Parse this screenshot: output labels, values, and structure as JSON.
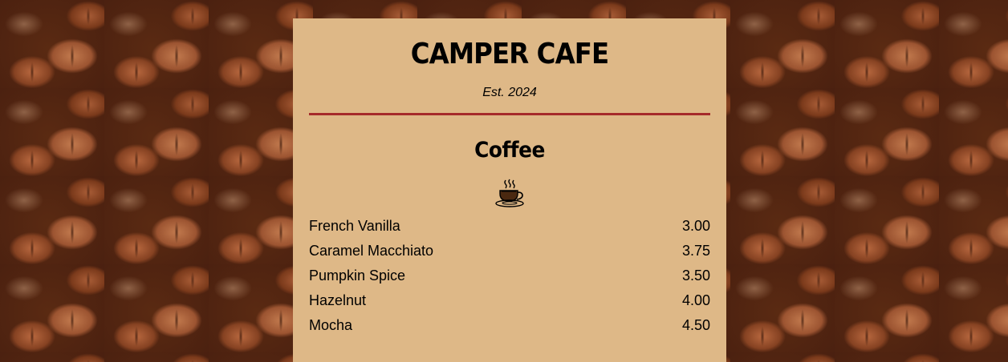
{
  "cafe": {
    "name": "CAMPER CAFE",
    "established": "Est. 2024"
  },
  "section": {
    "title": "Coffee",
    "icon": "coffee-cup-icon"
  },
  "items": [
    {
      "name": "French Vanilla",
      "price": "3.00"
    },
    {
      "name": "Caramel Macchiato",
      "price": "3.75"
    },
    {
      "name": "Pumpkin Spice",
      "price": "3.50"
    },
    {
      "name": "Hazelnut",
      "price": "4.00"
    },
    {
      "name": "Mocha",
      "price": "4.50"
    }
  ],
  "colors": {
    "menu_background": "#deb887",
    "divider": "#a52a2a"
  }
}
